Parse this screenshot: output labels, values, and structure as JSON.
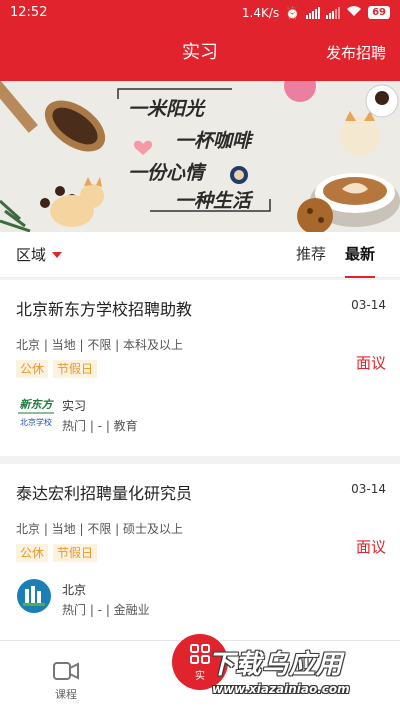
{
  "status_bar": {
    "time": "12:52",
    "speed": "1.4K/s",
    "battery": "69"
  },
  "header": {
    "title": "实习",
    "action_label": "发布招聘"
  },
  "banner": {
    "lines": [
      "一米阳光",
      "一杯咖啡",
      "一份心情",
      "一种生活"
    ]
  },
  "filter": {
    "region_label": "区域",
    "tabs": [
      {
        "label": "推荐",
        "active": false
      },
      {
        "label": "最新",
        "active": true
      }
    ]
  },
  "jobs": [
    {
      "title": "北京新东方学校招聘助教",
      "date": "03-14",
      "meta": "北京 | 当地 | 不限 | 本科及以上",
      "tags": [
        "公休",
        "节假日"
      ],
      "salary": "面议",
      "company_name": "实习",
      "company_info": "热门 | - | 教育",
      "logo_text_top": "新东方",
      "logo_text_bottom": "北京学校"
    },
    {
      "title": "泰达宏利招聘量化研究员",
      "date": "03-14",
      "meta": "北京 | 当地 | 不限 | 硕士及以上",
      "tags": [
        "公休",
        "节假日"
      ],
      "salary": "面议",
      "company_name": "北京",
      "company_info": "热门 | - | 金融业"
    }
  ],
  "tabbar": {
    "course_label": "课程",
    "fab_label": "实"
  },
  "watermark": {
    "title": "下载乌应用",
    "url": "www.xiazainiao.com"
  },
  "colors": {
    "primary": "#e0232c",
    "tag_text": "#e89a2a",
    "tag_bg": "#fdf1df"
  }
}
